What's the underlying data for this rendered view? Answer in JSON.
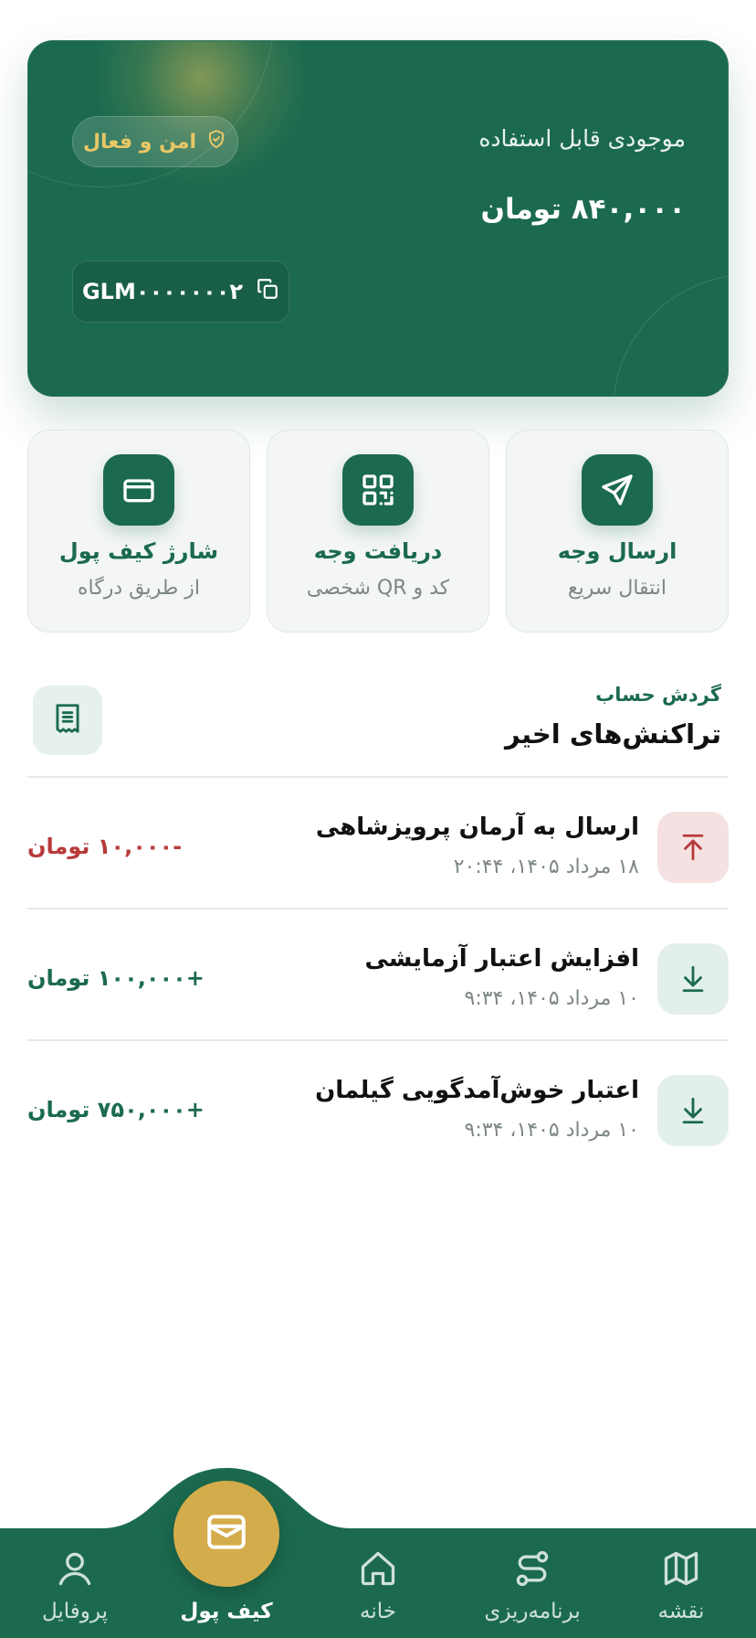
{
  "wallet": {
    "balance_label": "موجودی قابل استفاده",
    "balance_amount": "۸۴۰,۰۰۰ تومان",
    "secure_badge": "امن و فعال",
    "wallet_id": "GLM۰۰۰۰۰۰۰۲"
  },
  "actions": [
    {
      "title": "ارسال وجه",
      "subtitle": "انتقال سریع",
      "icon": "send-icon"
    },
    {
      "title": "دریافت وجه",
      "subtitle": "کد و QR شخصی",
      "icon": "qr-code-icon"
    },
    {
      "title": "شارژ کیف پول",
      "subtitle": "از طریق درگاه",
      "icon": "credit-card-icon"
    }
  ],
  "transactions_section": {
    "subtitle": "گردش حساب",
    "title": "تراکنش‌های اخیر"
  },
  "transactions": [
    {
      "name": "ارسال به آرمان پرویزشاهی",
      "date": "۱۸ مرداد ۱۴۰۵، ۲۰:۴۴",
      "amount": "-۱۰,۰۰۰ تومان",
      "direction": "outgoing"
    },
    {
      "name": "افزایش اعتبار آزمایشی",
      "date": "۱۰ مرداد ۱۴۰۵، ۹:۳۴",
      "amount": "+۱۰۰,۰۰۰ تومان",
      "direction": "incoming"
    },
    {
      "name": "اعتبار خوش‌آمدگویی گیلمان",
      "date": "۱۰ مرداد ۱۴۰۵، ۹:۳۴",
      "amount": "+۷۵۰,۰۰۰ تومان",
      "direction": "incoming"
    }
  ],
  "nav": {
    "items": [
      {
        "label": "نقشه",
        "icon": "map-icon"
      },
      {
        "label": "برنامه‌ریزی",
        "icon": "route-icon"
      },
      {
        "label": "خانه",
        "icon": "home-icon"
      },
      {
        "label": "کیف پول",
        "icon": "wallet-icon",
        "active": true
      },
      {
        "label": "پروفایل",
        "icon": "user-icon"
      }
    ]
  },
  "colors": {
    "primary": "#1b6a4f",
    "accent_gold": "#d4ac4b",
    "negative": "#b73a3a",
    "muted": "#7d8784"
  }
}
